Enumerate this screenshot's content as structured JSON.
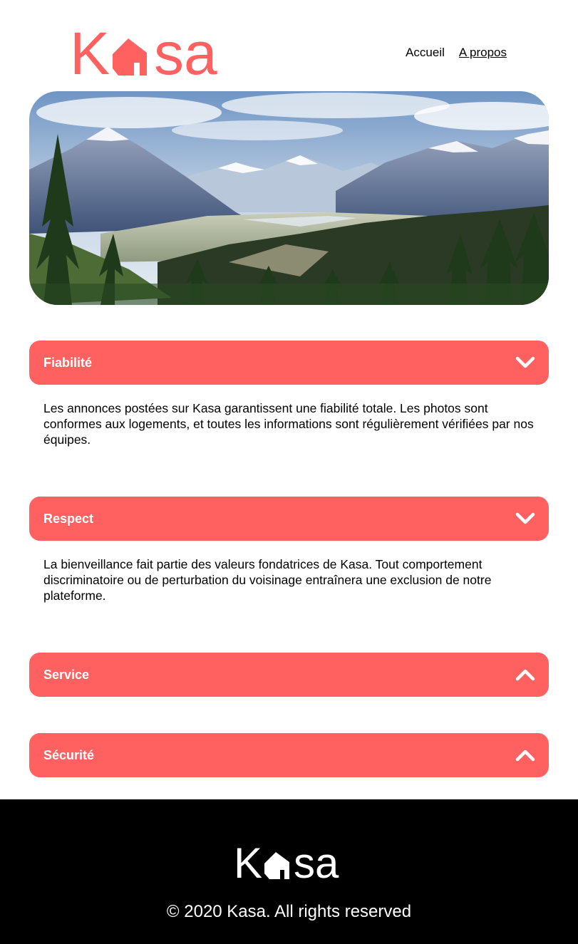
{
  "brand": {
    "name": "Kasa",
    "letters": [
      "K",
      "sa"
    ],
    "accent_color": "#FF6060"
  },
  "nav": {
    "items": [
      {
        "label": "Accueil",
        "active": false
      },
      {
        "label": "A propos",
        "active": true
      }
    ]
  },
  "banner": {
    "image": "mountain-landscape-image"
  },
  "accordion": [
    {
      "title": "Fiabilité",
      "expanded": true,
      "icon": "chevron-down-icon",
      "body": "Les annonces postées sur Kasa garantissent une fiabilité totale. Les photos sont conformes aux logements, et toutes les informations sont régulièrement vérifiées par nos équipes."
    },
    {
      "title": "Respect",
      "expanded": true,
      "icon": "chevron-down-icon",
      "body": "La bienveillance fait partie des valeurs fondatrices de Kasa. Tout comportement discriminatoire ou de perturbation du voisinage entraînera une exclusion de notre plateforme."
    },
    {
      "title": "Service",
      "expanded": false,
      "icon": "chevron-up-icon"
    },
    {
      "title": "Sécurité",
      "expanded": false,
      "icon": "chevron-up-icon"
    }
  ],
  "footer": {
    "copyright": "© 2020 Kasa. All rights reserved"
  }
}
